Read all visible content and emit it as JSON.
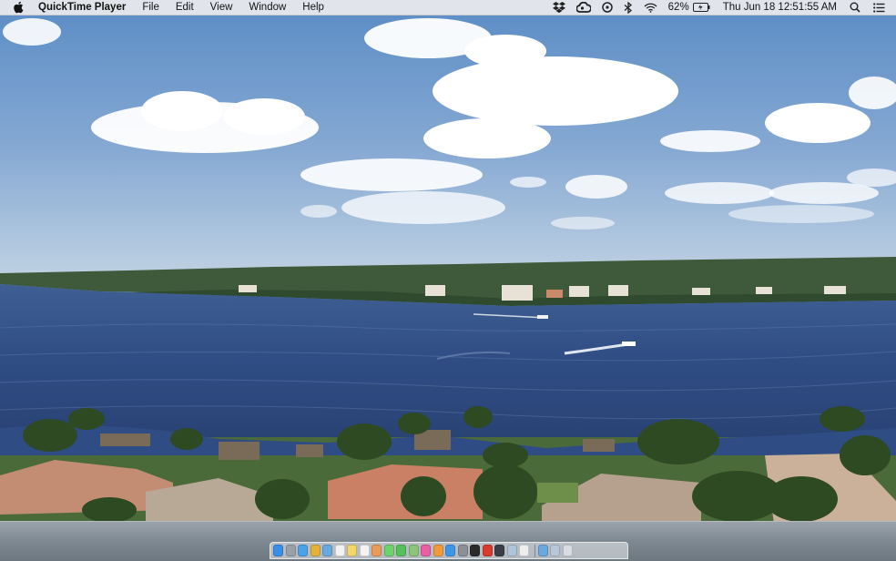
{
  "menubar": {
    "app_name": "QuickTime Player",
    "menus": [
      "File",
      "Edit",
      "View",
      "Window",
      "Help"
    ],
    "battery": "62%",
    "datetime": "Thu Jun 18  12:51:55 AM",
    "status_icons": [
      "dropbox-icon",
      "creative-cloud-icon",
      "sync-icon",
      "bluetooth-icon",
      "wifi-icon",
      "battery-icon",
      "spotlight-icon",
      "notification-center-icon"
    ]
  },
  "colors": {
    "sky_top": "#5f8fc6",
    "sky_bottom": "#b9cde0",
    "water": "#2f4f86",
    "menubar": "#ececee",
    "dock": "#8a939c"
  },
  "dock": {
    "apps": [
      {
        "icon": "finder-icon",
        "color": "#3a8ee6"
      },
      {
        "icon": "launchpad-icon",
        "color": "#9aa0a8"
      },
      {
        "icon": "safari-icon",
        "color": "#4aa3e8"
      },
      {
        "icon": "chrome-icon",
        "color": "#e2b33b"
      },
      {
        "icon": "mail-icon",
        "color": "#6aa9e0"
      },
      {
        "icon": "calendar-icon",
        "color": "#f2f2f2"
      },
      {
        "icon": "notes-icon",
        "color": "#f1d76c"
      },
      {
        "icon": "reminders-icon",
        "color": "#f4f4f4"
      },
      {
        "icon": "photos-icon",
        "color": "#e89b5a"
      },
      {
        "icon": "messages-icon",
        "color": "#6fd36b"
      },
      {
        "icon": "facetime-icon",
        "color": "#54c15a"
      },
      {
        "icon": "maps-icon",
        "color": "#8cc47a"
      },
      {
        "icon": "itunes-icon",
        "color": "#e85fa5"
      },
      {
        "icon": "ibooks-icon",
        "color": "#f19a3a"
      },
      {
        "icon": "app-store-icon",
        "color": "#3f95e8"
      },
      {
        "icon": "system-preferences-icon",
        "color": "#8c8f94"
      },
      {
        "icon": "terminal-icon",
        "color": "#2a2a2a"
      },
      {
        "icon": "acrobat-icon",
        "color": "#d83a2e"
      },
      {
        "icon": "quicktime-icon",
        "color": "#3a3f47"
      },
      {
        "icon": "preview-icon",
        "color": "#b0c4d8"
      },
      {
        "icon": "textedit-icon",
        "color": "#eeeeee"
      }
    ],
    "docs": [
      {
        "icon": "downloads-stack-icon",
        "color": "#6aa9e0"
      },
      {
        "icon": "documents-stack-icon",
        "color": "#b8c8d8"
      },
      {
        "icon": "trash-icon",
        "color": "#d8dde2"
      }
    ]
  }
}
